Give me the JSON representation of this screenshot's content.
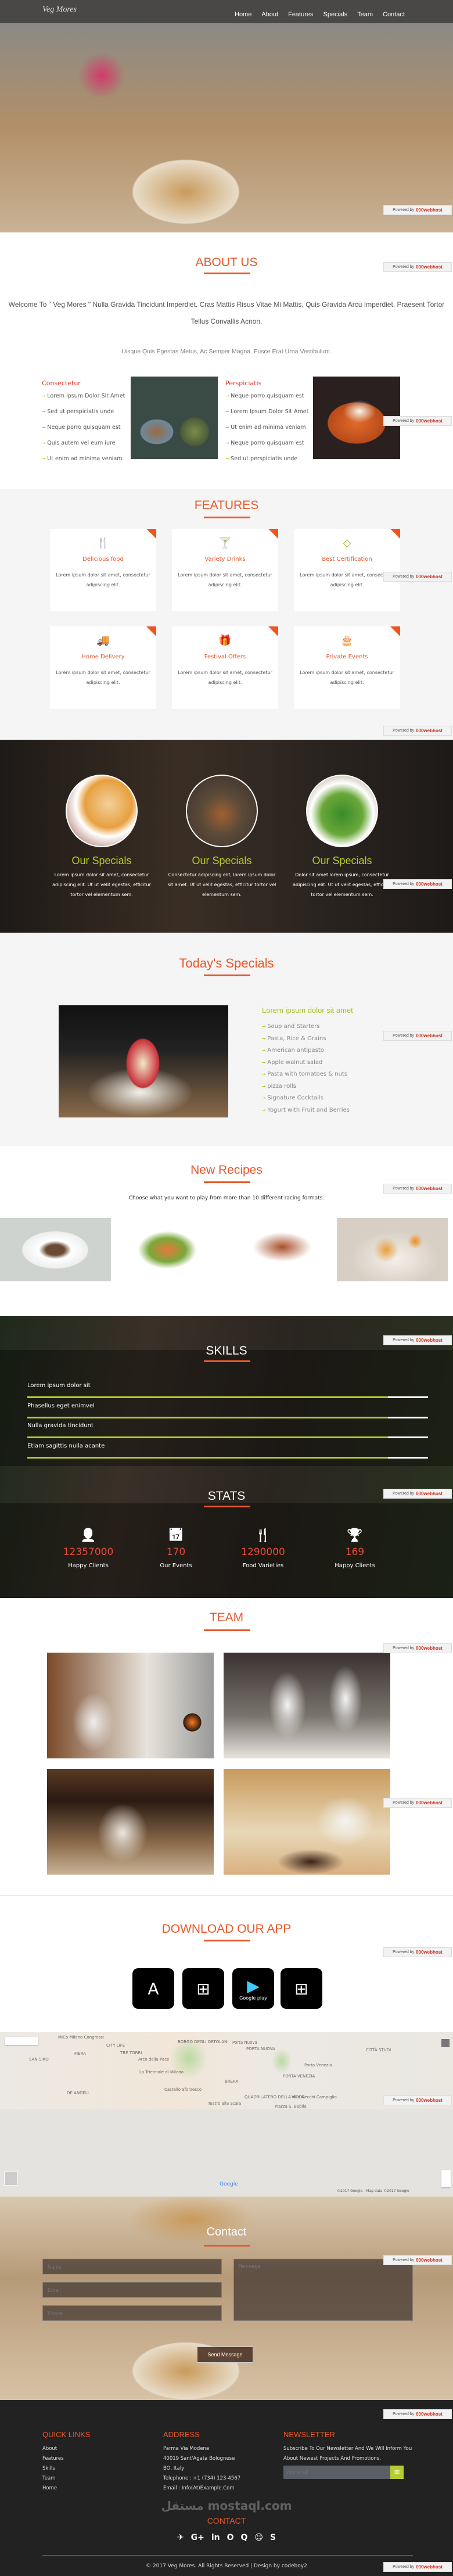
{
  "colors": {
    "accent": "#e8572a",
    "green": "#a8c31d",
    "dark": "#222222"
  },
  "header": {
    "brand": "Veg Mores",
    "nav": [
      "Home",
      "About",
      "Features",
      "Specials",
      "Team",
      "Contact"
    ]
  },
  "badge": {
    "powered": "Powered by",
    "host": "000webhost"
  },
  "about": {
    "title": "ABOUT US",
    "welcome": "Welcome To \" Veg Mores \" Nulla Gravida Tincidunt Imperdiet. Cras Mattis Risus Vitae Mi Mattis, Quis Gravida Arcu Imperdiet. Praesent Tortor Tellus Convallis Acnon.",
    "subtitle": "Uisque Quis Egestas Metus, Ac Semper Magna. Fusce Erat Urna Vestibulum.",
    "columns": [
      {
        "heading": "Consectetur",
        "items": [
          "Lorem Ipsum Dolor Sit Amet",
          "Sed ut perspiciatis unde",
          "Neque porro quisquam est",
          "Quis autem vel eum iure",
          "Ut enim ad minima veniam"
        ]
      },
      {
        "heading": "Perspiciatis",
        "items": [
          "Neque porro quisquam est",
          "Lorem Ipsum Dolor Sit Amet",
          "Ut enim ad minima veniam",
          "Neque porro quisquam est",
          "Sed ut perspiciatis unde"
        ]
      }
    ]
  },
  "features": {
    "title": "FEATURES",
    "cards": [
      {
        "icon": "cutlery-icon",
        "glyph": "🍴",
        "title": "Delicious food",
        "desc": "Lorem ipsum dolor sit amet, consectetur adipiscing elit."
      },
      {
        "icon": "cocktail-icon",
        "glyph": "🍸",
        "title": "Variety Drinks",
        "desc": "Lorem ipsum dolor sit amet, consectetur adipiscing elit."
      },
      {
        "icon": "diamond-icon",
        "glyph": "◇",
        "title": "Best Certification",
        "desc": "Lorem ipsum dolor sit amet, consectetur adipiscing elit."
      },
      {
        "icon": "truck-icon",
        "glyph": "🚚",
        "title": "Home Delivery",
        "desc": "Lorem ipsum dolor sit amet, consectetur adipiscing elit."
      },
      {
        "icon": "gift-icon",
        "glyph": "🎁",
        "title": "Festival Offers",
        "desc": "Lorem ipsum dolor sit amet, consectetur adipiscing elit."
      },
      {
        "icon": "cake-icon",
        "glyph": "🎂",
        "title": "Private Events",
        "desc": "Lorem ipsum dolor sit amet, consectetur adipiscing elit."
      }
    ]
  },
  "specials": {
    "items": [
      {
        "title": "Our Specials",
        "desc": "Lorem ipsum dolor sit amet, consectetur adipiscing elit. Ut ut velit egestas, efficitur tortor vel elementum sem."
      },
      {
        "title": "Our Specials",
        "desc": "Consectetur adipiscing elit, lorem ipsum dolor sit amet. Ut ut velit egestas, efficitur tortor vel elementum sem."
      },
      {
        "title": "Our Specials",
        "desc": "Dolor sit amet lorem ipsum, consectetur adipiscing elit. Ut ut velit egestas, efficitur tortor vel elementum sem."
      }
    ]
  },
  "today": {
    "title": "Today's Specials",
    "heading": "Lorem ipsum dolor sit amet",
    "items": [
      "Soup and Starters",
      "Pasta, Rice & Grains",
      "American antipasto",
      "Apple walnut salad",
      "Pasta with tomatoes & nuts",
      "pizza rolls",
      "Signature Cocktails",
      "Yogurt with Fruit and Berries"
    ]
  },
  "recipes": {
    "title": "New Recipes",
    "subtitle": "Choose what you want to play from more than 10 different racing formats."
  },
  "skills": {
    "title": "SKILLS",
    "items": [
      {
        "label": "Lorem ipsum dolor sit",
        "percent": 90
      },
      {
        "label": "Phasellus eget enimvel",
        "percent": 90
      },
      {
        "label": "Nulla gravida tincidunt",
        "percent": 90
      },
      {
        "label": "Etiam sagittis nulla acante",
        "percent": 90
      }
    ]
  },
  "stats": {
    "title": "STATS",
    "items": [
      {
        "icon": "user-icon",
        "glyph": "👤",
        "value": "12357000",
        "label": "Happy Clients"
      },
      {
        "icon": "calendar-icon",
        "glyph": "📅",
        "value": "170",
        "label": "Our Events"
      },
      {
        "icon": "cutlery-icon",
        "glyph": "🍴",
        "value": "1290000",
        "label": "Food Varieties"
      },
      {
        "icon": "trophy-icon",
        "glyph": "🏆",
        "value": "169",
        "label": "Happy Clients"
      }
    ]
  },
  "team": {
    "title": "TEAM"
  },
  "download": {
    "title": "DOWNLOAD OUR APP",
    "stores": [
      {
        "icon": "app-store-icon",
        "glyph": "A",
        "label": ""
      },
      {
        "icon": "windows-icon",
        "glyph": "⊞",
        "label": ""
      },
      {
        "icon": "google-play-icon",
        "glyph": "▶",
        "label": "Google play"
      },
      {
        "icon": "windows-store-icon",
        "glyph": "⊞",
        "label": ""
      }
    ]
  },
  "map": {
    "labels": [
      "MiCo Milano Congressi",
      "CITY LIFE",
      "FIERA",
      "TRE TORRI",
      "SAN SIRO",
      "BORGO DEGLI ORTOLANI",
      "Porta Nuova",
      "PORTA NUOVA",
      "Arco della Pace",
      "La Triennale di Milano",
      "Castello Sforzesco",
      "BRERA",
      "Porta Venezia",
      "PORTA VENEZIA",
      "CITTÀ STUDI",
      "DE ANGELI",
      "QUADRILATERO DELLA MODA",
      "Villa Necchi Campiglio",
      "Teatro alla Scala",
      "Piazza S. Babila"
    ],
    "google": "Google",
    "attribution": "©2017 Google - Map data ©2017 Google"
  },
  "contact": {
    "title": "Contact",
    "name_placeholder": "Name",
    "email_placeholder": "Email",
    "phone_placeholder": "Phone",
    "message_placeholder": "Message",
    "send": "Send Message"
  },
  "footer": {
    "quick_title": "QUICK LINKS",
    "quick_links": [
      "About",
      "Features",
      "Skills",
      "Team",
      "Home"
    ],
    "address_title": "ADDRESS",
    "address": [
      "Parma Via Modena",
      "40019 Sant'Agata Bolognese",
      "BO, Italy",
      "Telephone : +1 (734) 123-4567",
      "Email : Info(At)Example.Com"
    ],
    "newsletter_title": "NEWSLETTER",
    "newsletter_text": [
      "Subscribe To Our Newsletter And We Will Inform You",
      "About Newest Projects And Promotions."
    ],
    "email_placeholder": "your email",
    "contact_label": "CONTACT",
    "watermark": "مستقل mostaql.com",
    "social": [
      {
        "icon": "telegram-icon",
        "glyph": "✈"
      },
      {
        "icon": "google-plus-icon",
        "glyph": "G+"
      },
      {
        "icon": "linkedin-icon",
        "glyph": "in"
      },
      {
        "icon": "opera-icon",
        "glyph": "O"
      },
      {
        "icon": "quora-icon",
        "glyph": "Q"
      },
      {
        "icon": "snapchat-icon",
        "glyph": "☺"
      },
      {
        "icon": "skype-icon",
        "glyph": "S"
      }
    ],
    "copyright": "© 2017 Veg Mores. All Rights Reserved | Design by codeboy2"
  }
}
